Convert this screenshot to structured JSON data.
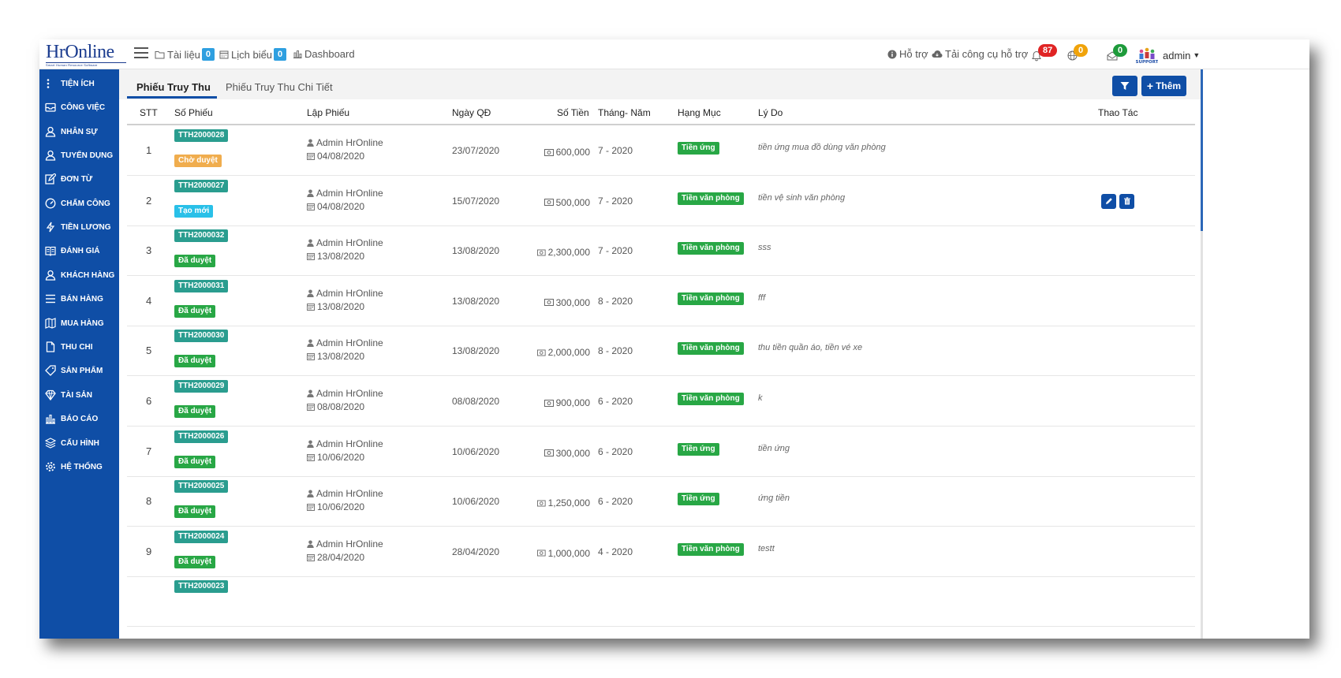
{
  "header": {
    "logo_text": "HrOnline",
    "logo_sub": "Smart Human Resource Software",
    "nav": [
      {
        "label": "Tài liệu",
        "count": "0"
      },
      {
        "label": "Lịch biểu",
        "count": "0"
      },
      {
        "label": "Dashboard"
      }
    ],
    "support_label": "Hỗ trợ",
    "download_label": "Tải công cụ hỗ trợ",
    "notifications": {
      "bell": "87",
      "globe": "0",
      "mail": "0"
    },
    "badge_colors": {
      "bell": "#e02424",
      "globe": "#f0a30a",
      "mail": "#1e9b3b"
    },
    "user": "admin"
  },
  "sidebar": {
    "items": [
      {
        "label": "TIỆN ÍCH",
        "icon": "dots-vertical-icon"
      },
      {
        "label": "CÔNG VIỆC",
        "icon": "inbox-icon"
      },
      {
        "label": "NHÂN SỰ",
        "icon": "user-icon"
      },
      {
        "label": "TUYỂN DỤNG",
        "icon": "user-icon"
      },
      {
        "label": "ĐƠN TỪ",
        "icon": "edit-icon"
      },
      {
        "label": "CHẤM CÔNG",
        "icon": "speedometer-icon"
      },
      {
        "label": "TIỀN LƯƠNG",
        "icon": "bolt-icon"
      },
      {
        "label": "ĐÁNH GIÁ",
        "icon": "book-icon"
      },
      {
        "label": "KHÁCH HÀNG",
        "icon": "user-icon"
      },
      {
        "label": "BÁN HÀNG",
        "icon": "menu-icon"
      },
      {
        "label": "MUA HÀNG",
        "icon": "map-icon"
      },
      {
        "label": "THU CHI",
        "icon": "file-icon"
      },
      {
        "label": "SẢN PHẨM",
        "icon": "tag-icon"
      },
      {
        "label": "TÀI SẢN",
        "icon": "diamond-icon"
      },
      {
        "label": "BÁO CÁO",
        "icon": "bar-chart-icon"
      },
      {
        "label": "CẤU HÌNH",
        "icon": "layers-icon"
      },
      {
        "label": "HỆ THỐNG",
        "icon": "gear-icon"
      }
    ]
  },
  "tabs": [
    {
      "label": "Phiếu Truy Thu",
      "active": true
    },
    {
      "label": "Phiếu Truy Thu Chi Tiết",
      "active": false
    }
  ],
  "toolbar": {
    "filter_icon": "filter-icon",
    "add_label": "Thêm"
  },
  "table": {
    "columns": [
      "STT",
      "Số Phiếu",
      "Lập Phiếu",
      "Ngày QĐ",
      "Số Tiền",
      "Tháng- Năm",
      "Hạng Mục",
      "Lý Do",
      "Thao Tác"
    ],
    "status_colors": {
      "Chờ duyệt": "#f0ad4e",
      "Tạo mới": "#29c0e8",
      "Đã duyệt": "#28a745"
    },
    "category_color": "#28a745",
    "rows": [
      {
        "stt": "1",
        "code": "TTH2000028",
        "status": "Chờ duyệt",
        "creator": "Admin HrOnline",
        "created": "04/08/2020",
        "decision_date": "23/07/2020",
        "amount": "600,000",
        "period": "7 - 2020",
        "category": "Tiền ứng",
        "reason": "tiền ứng mua đồ dùng văn phòng"
      },
      {
        "stt": "2",
        "code": "TTH2000027",
        "status": "Tạo mới",
        "creator": "Admin HrOnline",
        "created": "04/08/2020",
        "decision_date": "15/07/2020",
        "amount": "500,000",
        "period": "7 - 2020",
        "category": "Tiền văn phòng",
        "reason": "tiền vệ sinh văn phòng",
        "actions": true
      },
      {
        "stt": "3",
        "code": "TTH2000032",
        "status": "Đã duyệt",
        "creator": "Admin HrOnline",
        "created": "13/08/2020",
        "decision_date": "13/08/2020",
        "amount": "2,300,000",
        "period": "7 - 2020",
        "category": "Tiền văn phòng",
        "reason": "sss"
      },
      {
        "stt": "4",
        "code": "TTH2000031",
        "status": "Đã duyệt",
        "creator": "Admin HrOnline",
        "created": "13/08/2020",
        "decision_date": "13/08/2020",
        "amount": "300,000",
        "period": "8 - 2020",
        "category": "Tiền văn phòng",
        "reason": "fff"
      },
      {
        "stt": "5",
        "code": "TTH2000030",
        "status": "Đã duyệt",
        "creator": "Admin HrOnline",
        "created": "13/08/2020",
        "decision_date": "13/08/2020",
        "amount": "2,000,000",
        "period": "8 - 2020",
        "category": "Tiền văn phòng",
        "reason": "thu tiền quần áo, tiền vé xe"
      },
      {
        "stt": "6",
        "code": "TTH2000029",
        "status": "Đã duyệt",
        "creator": "Admin HrOnline",
        "created": "08/08/2020",
        "decision_date": "08/08/2020",
        "amount": "900,000",
        "period": "6 - 2020",
        "category": "Tiền văn phòng",
        "reason": "k"
      },
      {
        "stt": "7",
        "code": "TTH2000026",
        "status": "Đã duyệt",
        "creator": "Admin HrOnline",
        "created": "10/06/2020",
        "decision_date": "10/06/2020",
        "amount": "300,000",
        "period": "6 - 2020",
        "category": "Tiền ứng",
        "reason": "tiền ứng"
      },
      {
        "stt": "8",
        "code": "TTH2000025",
        "status": "Đã duyệt",
        "creator": "Admin HrOnline",
        "created": "10/06/2020",
        "decision_date": "10/06/2020",
        "amount": "1,250,000",
        "period": "6 - 2020",
        "category": "Tiền ứng",
        "reason": "ứng tiền"
      },
      {
        "stt": "9",
        "code": "TTH2000024",
        "status": "Đã duyệt",
        "creator": "Admin HrOnline",
        "created": "28/04/2020",
        "decision_date": "28/04/2020",
        "amount": "1,000,000",
        "period": "4 - 2020",
        "category": "Tiền văn phòng",
        "reason": "testt"
      },
      {
        "stt": "",
        "code": "TTH2000023",
        "status": "",
        "creator": "",
        "created": "",
        "decision_date": "",
        "amount": "",
        "period": "",
        "category": "",
        "reason": ""
      }
    ]
  }
}
